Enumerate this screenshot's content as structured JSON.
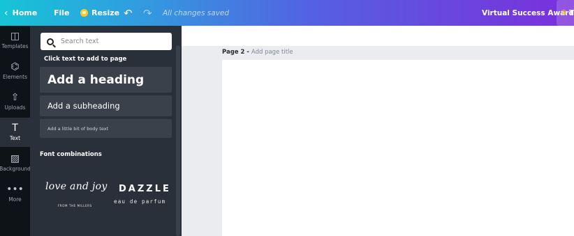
{
  "topbar": {
    "home_label": "Home",
    "file_label": "File",
    "resize_label": "Resize",
    "undo_icon": "↶",
    "redo_icon": "↷",
    "status": "All changes saved",
    "design_title": "Virtual Success Awards",
    "upgrade_label": "T",
    "gradient_colors": [
      "#16c4d6",
      "#5560e2",
      "#7b2fdb"
    ]
  },
  "rail": {
    "items": [
      {
        "label": "Templates",
        "icon": "◫"
      },
      {
        "label": "Elements",
        "icon": "⌬"
      },
      {
        "label": "Uploads",
        "icon": "⇧"
      },
      {
        "label": "Text",
        "icon": "T"
      },
      {
        "label": "Background",
        "icon": "▨"
      },
      {
        "label": "More",
        "icon": "•••"
      }
    ],
    "active": "Text"
  },
  "panel": {
    "search_placeholder": "Search text",
    "click_label": "Click text to add to page",
    "heading": "Add a heading",
    "subheading": "Add a subheading",
    "body": "Add a little bit of body text",
    "font_combinations_label": "Font combinations",
    "combos": [
      {
        "main": "love and joy",
        "sub": "FROM THE MILLERS"
      },
      {
        "main": "DAZZLE",
        "sub": "eau de parfum"
      }
    ]
  },
  "canvas": {
    "page_number": "Page 2",
    "separator": " - ",
    "page_title_placeholder": "Add page title"
  }
}
